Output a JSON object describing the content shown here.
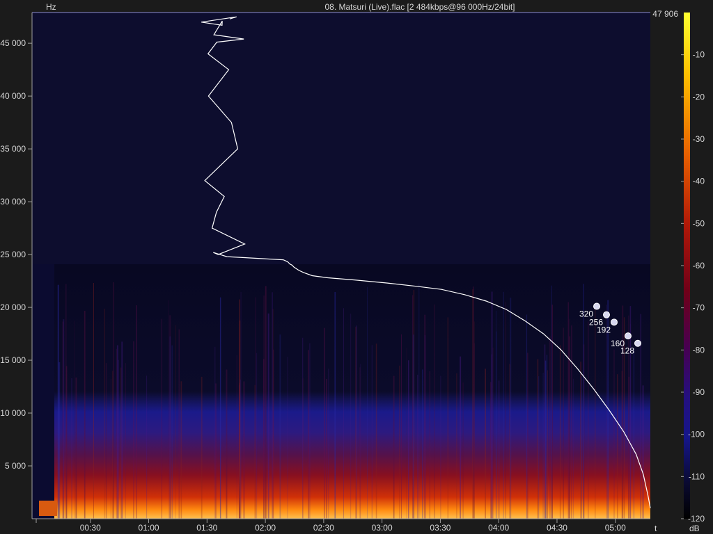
{
  "title": "08. Matsuri (Live).flac [2 484kbps@96 000Hz/24bit]",
  "chart_data": {
    "type": "heatmap",
    "title": "08. Matsuri (Live).flac [2 484kbps@96 000Hz/24bit]",
    "y_axis": {
      "label": "Hz",
      "max_label": "47 906",
      "range": [
        0,
        47906
      ],
      "ticks": [
        {
          "value": 5000,
          "label": "5 000"
        },
        {
          "value": 10000,
          "label": "10 000"
        },
        {
          "value": 15000,
          "label": "15 000"
        },
        {
          "value": 20000,
          "label": "20 000"
        },
        {
          "value": 25000,
          "label": "25 000"
        },
        {
          "value": 30000,
          "label": "30 000"
        },
        {
          "value": 35000,
          "label": "35 000"
        },
        {
          "value": 40000,
          "label": "40 000"
        },
        {
          "value": 45000,
          "label": "45 000"
        }
      ]
    },
    "x_axis": {
      "label": "t",
      "range_seconds": [
        0,
        318
      ],
      "ticks": [
        {
          "value": 30,
          "label": "00:30"
        },
        {
          "value": 60,
          "label": "01:00"
        },
        {
          "value": 90,
          "label": "01:30"
        },
        {
          "value": 120,
          "label": "02:00"
        },
        {
          "value": 150,
          "label": "02:30"
        },
        {
          "value": 180,
          "label": "03:00"
        },
        {
          "value": 210,
          "label": "03:30"
        },
        {
          "value": 240,
          "label": "04:00"
        },
        {
          "value": 270,
          "label": "04:30"
        },
        {
          "value": 300,
          "label": "05:00"
        }
      ]
    },
    "color_scale": {
      "label": "dB",
      "range": [
        -120,
        0
      ],
      "ticks": [
        {
          "value": -10,
          "label": "-10"
        },
        {
          "value": -20,
          "label": "-20"
        },
        {
          "value": -30,
          "label": "-30"
        },
        {
          "value": -40,
          "label": "-40"
        },
        {
          "value": -50,
          "label": "-50"
        },
        {
          "value": -60,
          "label": "-60"
        },
        {
          "value": -70,
          "label": "-70"
        },
        {
          "value": -80,
          "label": "-80"
        },
        {
          "value": -90,
          "label": "-90"
        },
        {
          "value": -100,
          "label": "-100"
        },
        {
          "value": -110,
          "label": "-110"
        },
        {
          "value": -120,
          "label": "-120"
        }
      ],
      "colors": [
        "#ffff30",
        "#ffc000",
        "#f07000",
        "#c02000",
        "#800000",
        "#500040",
        "#281070",
        "#15158a",
        "#0a0a2a",
        "#000000"
      ]
    },
    "spectrum_cutoff_hz": 24000,
    "cutoff_curve": [
      [
        0.0,
        47300
      ],
      [
        0.05,
        47500
      ],
      [
        0.1,
        47000
      ],
      [
        0.15,
        46700
      ],
      [
        0.2,
        47100
      ],
      [
        0.28,
        45800
      ],
      [
        0.35,
        45400
      ],
      [
        0.45,
        45100
      ],
      [
        0.55,
        44000
      ],
      [
        0.7,
        42500
      ],
      [
        0.85,
        40000
      ],
      [
        1.0,
        37500
      ],
      [
        1.2,
        35000
      ],
      [
        1.4,
        32000
      ],
      [
        1.6,
        30500
      ],
      [
        1.8,
        29000
      ],
      [
        2.0,
        27500
      ],
      [
        2.2,
        26000
      ],
      [
        2.4,
        25000
      ],
      [
        2.6,
        25200
      ],
      [
        2.8,
        24800
      ],
      [
        3.0,
        24500
      ],
      [
        3.2,
        24400
      ],
      [
        3.4,
        24300
      ],
      [
        3.6,
        24100
      ],
      [
        3.8,
        24000
      ],
      [
        4.0,
        23800
      ],
      [
        4.5,
        23500
      ],
      [
        5.0,
        23300
      ],
      [
        6.0,
        23000
      ],
      [
        8.0,
        22800
      ],
      [
        12.0,
        22600
      ],
      [
        18.0,
        22300
      ],
      [
        24.0,
        22000
      ],
      [
        30.0,
        21700
      ],
      [
        36.0,
        21200
      ],
      [
        42.0,
        20600
      ],
      [
        48.0,
        19800
      ],
      [
        54.0,
        18700
      ],
      [
        60.0,
        17500
      ],
      [
        66.0,
        16000
      ],
      [
        72.0,
        14200
      ],
      [
        78.0,
        12300
      ],
      [
        84.0,
        10300
      ],
      [
        90.0,
        8200
      ],
      [
        95.0,
        6100
      ],
      [
        98.0,
        4200
      ],
      [
        100.0,
        2200
      ],
      [
        101.0,
        1000
      ]
    ],
    "bitrate_markers": [
      {
        "label": "320",
        "freq_hz": 20100
      },
      {
        "label": "256",
        "freq_hz": 19300
      },
      {
        "label": "192",
        "freq_hz": 18600
      },
      {
        "label": "160",
        "freq_hz": 17300
      },
      {
        "label": "128",
        "freq_hz": 16600
      }
    ]
  }
}
